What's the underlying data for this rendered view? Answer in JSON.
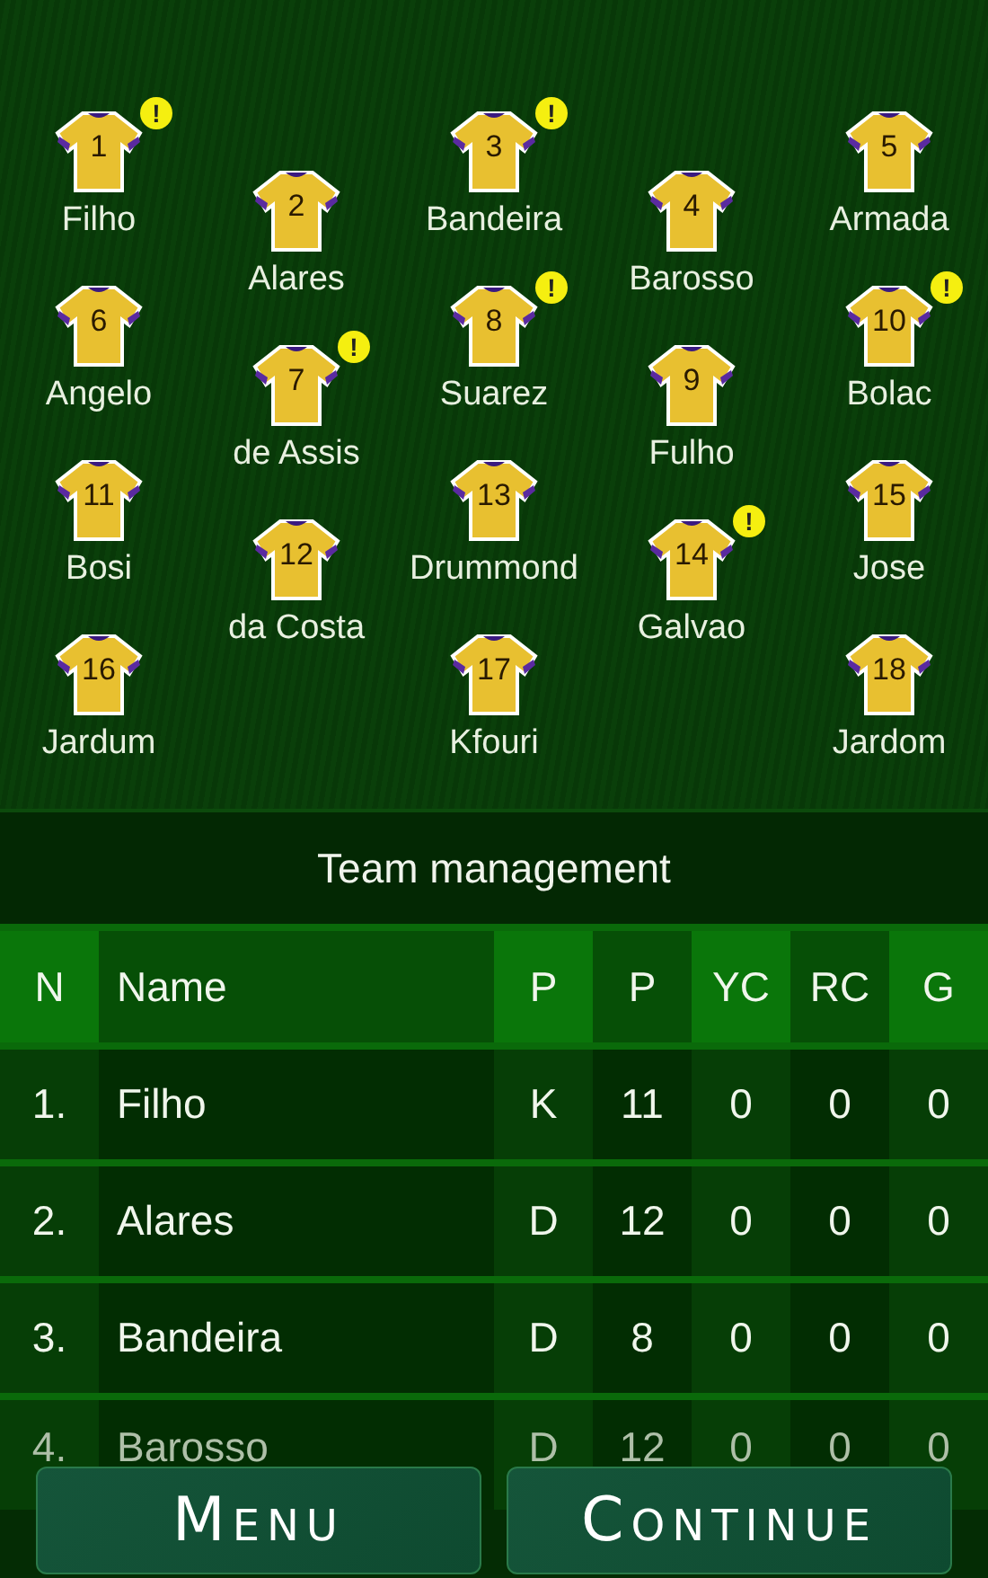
{
  "pitch": {
    "columns": [
      [
        {
          "number": "1",
          "name": "Filho",
          "warning": true
        },
        {
          "number": "6",
          "name": "Angelo",
          "warning": false
        },
        {
          "number": "11",
          "name": "Bosi",
          "warning": false
        },
        {
          "number": "16",
          "name": "Jardum",
          "warning": false
        }
      ],
      [
        {
          "number": "2",
          "name": "Alares",
          "warning": false
        },
        {
          "number": "7",
          "name": "de Assis",
          "warning": true
        },
        {
          "number": "12",
          "name": "da Costa",
          "warning": false
        }
      ],
      [
        {
          "number": "3",
          "name": "Bandeira",
          "warning": true
        },
        {
          "number": "8",
          "name": "Suarez",
          "warning": true
        },
        {
          "number": "13",
          "name": "Drummond",
          "warning": false
        },
        {
          "number": "17",
          "name": "Kfouri",
          "warning": false
        }
      ],
      [
        {
          "number": "4",
          "name": "Barosso",
          "warning": false
        },
        {
          "number": "9",
          "name": "Fulho",
          "warning": false
        },
        {
          "number": "14",
          "name": "Galvao",
          "warning": true
        }
      ],
      [
        {
          "number": "5",
          "name": "Armada",
          "warning": false
        },
        {
          "number": "10",
          "name": "Bolac",
          "warning": true
        },
        {
          "number": "15",
          "name": "Jose",
          "warning": false
        },
        {
          "number": "18",
          "name": "Jardom",
          "warning": false
        }
      ]
    ],
    "warning_mark": "!"
  },
  "section_title": "Team management",
  "table": {
    "columns": [
      "N",
      "Name",
      "P",
      "P",
      "YC",
      "RC",
      "G"
    ],
    "rows": [
      [
        "1.",
        "Filho",
        "K",
        "11",
        "0",
        "0",
        "0"
      ],
      [
        "2.",
        "Alares",
        "D",
        "12",
        "0",
        "0",
        "0"
      ],
      [
        "3.",
        "Bandeira",
        "D",
        "8",
        "0",
        "0",
        "0"
      ],
      [
        "4.",
        "Barosso",
        "D",
        "12",
        "0",
        "0",
        "0"
      ]
    ]
  },
  "buttons": [
    "Menu",
    "Continue"
  ]
}
